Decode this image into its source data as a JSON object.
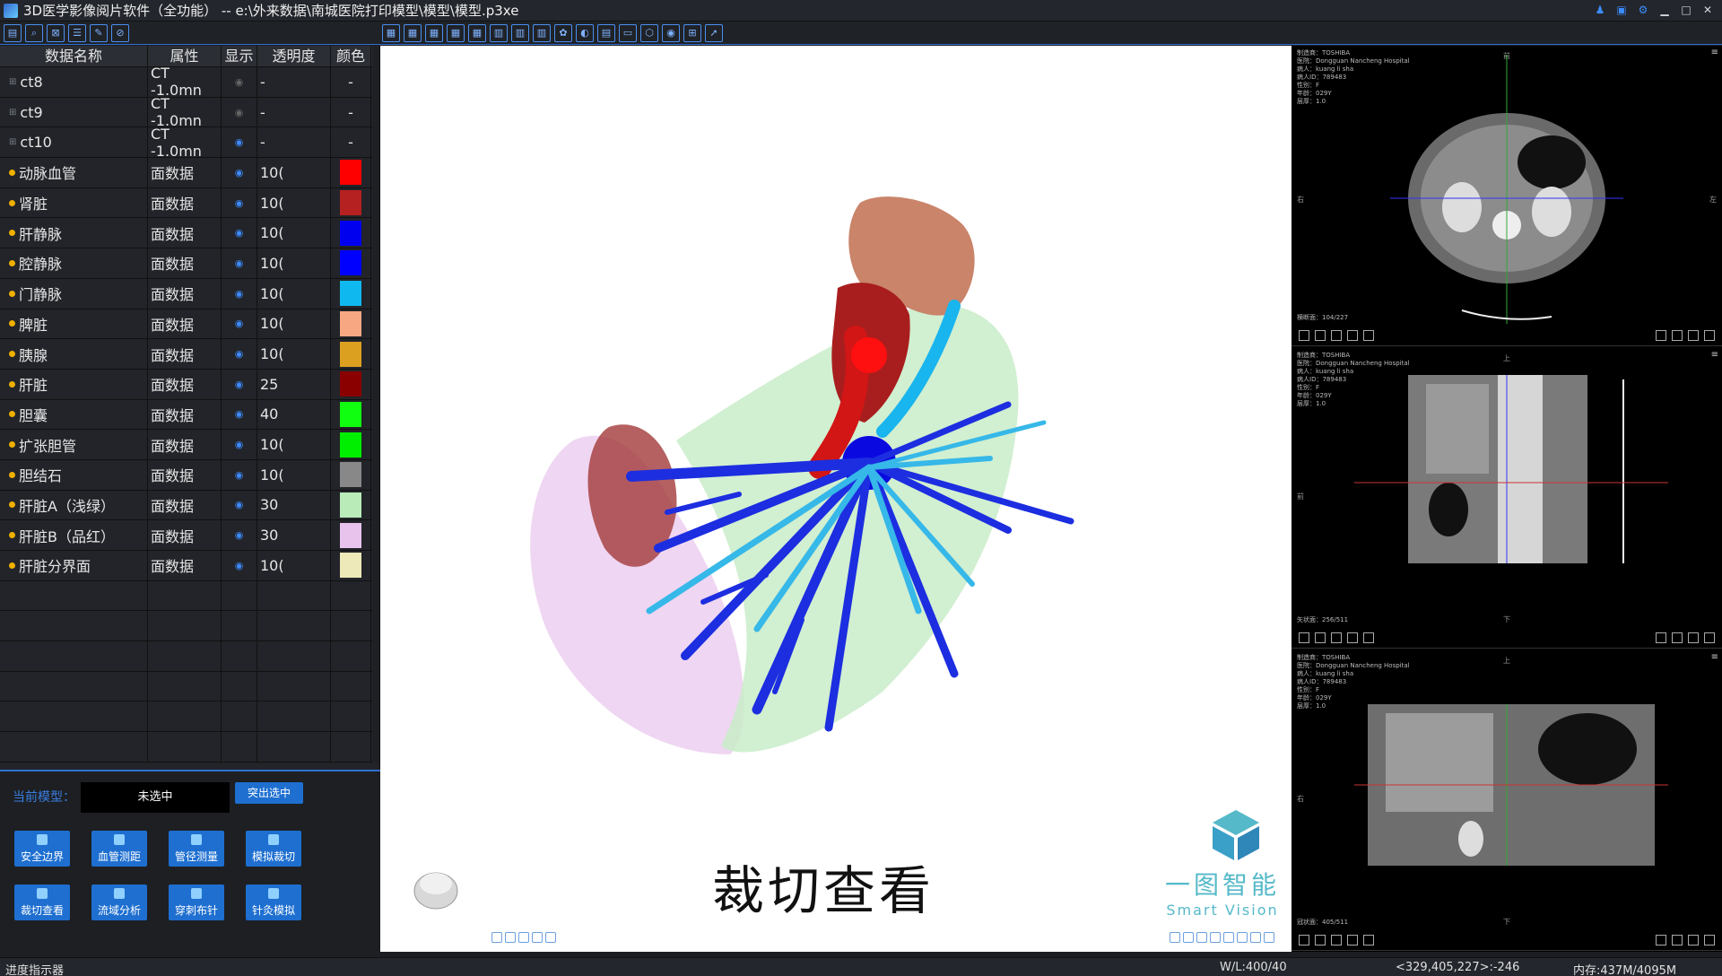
{
  "window": {
    "title": "3D医学影像阅片软件（全功能） -- e:\\外来数据\\南城医院打印模型\\模型\\模型.p3xe"
  },
  "table": {
    "headers": [
      "数据名称",
      "属性",
      "显示",
      "透明度",
      "颜色"
    ],
    "rows": [
      {
        "name": "ct8",
        "attr": "CT -1.0mn",
        "visible": false,
        "opacity": "-",
        "color": "-",
        "kind": "volume"
      },
      {
        "name": "ct9",
        "attr": "CT -1.0mn",
        "visible": false,
        "opacity": "-",
        "color": "-",
        "kind": "volume"
      },
      {
        "name": "ct10",
        "attr": "CT -1.0mn",
        "visible": true,
        "opacity": "-",
        "color": "-",
        "kind": "volume"
      },
      {
        "name": "动脉血管",
        "attr": "面数据",
        "visible": true,
        "opacity": "10(",
        "color": "#ff0000",
        "kind": "surface"
      },
      {
        "name": "肾脏",
        "attr": "面数据",
        "visible": true,
        "opacity": "10(",
        "color": "#b52020",
        "kind": "surface"
      },
      {
        "name": "肝静脉",
        "attr": "面数据",
        "visible": true,
        "opacity": "10(",
        "color": "#0000ee",
        "kind": "surface"
      },
      {
        "name": "腔静脉",
        "attr": "面数据",
        "visible": true,
        "opacity": "10(",
        "color": "#0000ff",
        "kind": "surface"
      },
      {
        "name": "门静脉",
        "attr": "面数据",
        "visible": true,
        "opacity": "10(",
        "color": "#10b8f0",
        "kind": "surface"
      },
      {
        "name": "脾脏",
        "attr": "面数据",
        "visible": true,
        "opacity": "10(",
        "color": "#f7a883",
        "kind": "surface"
      },
      {
        "name": "胰腺",
        "attr": "面数据",
        "visible": true,
        "opacity": "10(",
        "color": "#dca020",
        "kind": "surface"
      },
      {
        "name": "肝脏",
        "attr": "面数据",
        "visible": true,
        "opacity": "25",
        "color": "#8a0000",
        "kind": "surface"
      },
      {
        "name": "胆囊",
        "attr": "面数据",
        "visible": true,
        "opacity": "40",
        "color": "#10ff10",
        "kind": "surface"
      },
      {
        "name": "扩张胆管",
        "attr": "面数据",
        "visible": true,
        "opacity": "10(",
        "color": "#00ee00",
        "kind": "surface"
      },
      {
        "name": "胆结石",
        "attr": "面数据",
        "visible": true,
        "opacity": "10(",
        "color": "#888888",
        "kind": "surface"
      },
      {
        "name": "肝脏A（浅绿）",
        "attr": "面数据",
        "visible": true,
        "opacity": "30",
        "color": "#b8ebb8",
        "kind": "surface"
      },
      {
        "name": "肝脏B（品红）",
        "attr": "面数据",
        "visible": true,
        "opacity": "30",
        "color": "#e8c4ec",
        "kind": "surface"
      },
      {
        "name": "肝脏分界面",
        "attr": "面数据",
        "visible": true,
        "opacity": "10(",
        "color": "#ede9b8",
        "kind": "surface"
      }
    ]
  },
  "controls": {
    "current_model_label": "当前模型：",
    "current_model_value": "未选中",
    "highlight_button": "突出选中",
    "tools": [
      "安全边界",
      "血管测距",
      "管径测量",
      "模拟裁切",
      "裁切查看",
      "流域分析",
      "穿刺布针",
      "针灸模拟"
    ]
  },
  "viewport": {
    "caption": "裁切查看",
    "logo_cn": "一图智能",
    "logo_en": "Smart Vision"
  },
  "mpr_views": [
    {
      "meta": [
        "制造商：TOSHIBA",
        "医院：Dongguan Nancheng Hospital",
        "病人：kuang li sha",
        "病人ID：789483",
        "性别：F",
        "年龄：029Y",
        "层厚：1.0"
      ],
      "slice": "横断面：104/227",
      "top": "前",
      "left": "右",
      "right": "左"
    },
    {
      "meta": [
        "制造商：TOSHIBA",
        "医院：Dongguan Nancheng Hospital",
        "病人：kuang li sha",
        "病人ID：789483",
        "性别：F",
        "年龄：029Y",
        "层厚：1.0"
      ],
      "slice": "矢状面：256/511",
      "top": "上",
      "left": "前",
      "bottom": "下"
    },
    {
      "meta": [
        "制造商：TOSHIBA",
        "医院：Dongguan Nancheng Hospital",
        "病人：kuang li sha",
        "病人ID：789483",
        "性别：F",
        "年龄：029Y",
        "层厚：1.0"
      ],
      "slice": "冠状面：405/511",
      "top": "上",
      "left": "右",
      "bottom": "下"
    }
  ],
  "status": {
    "progress_label": "进度指示器",
    "wl": "W/L:400/40",
    "coord": "<329,405,227>:-246",
    "memory": "内存:437M/4095M"
  },
  "colors": {
    "accent": "#1e6fd0",
    "panel_bg": "#222429"
  }
}
